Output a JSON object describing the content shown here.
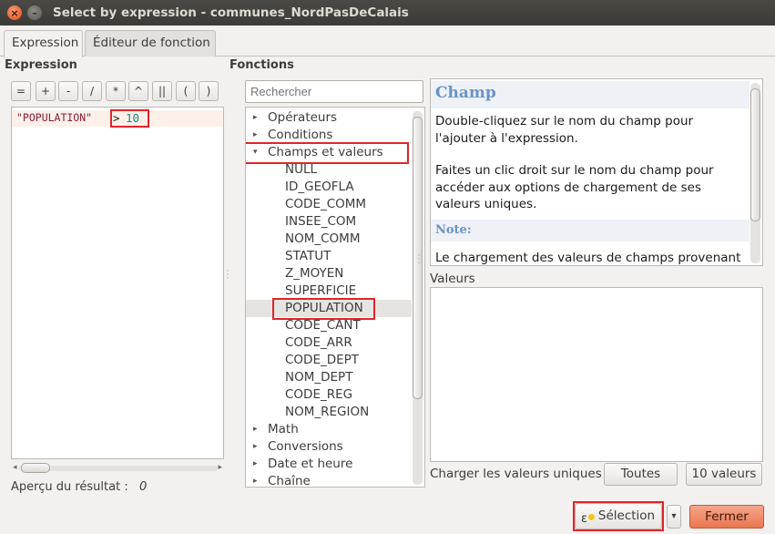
{
  "window": {
    "title": "Select by expression - communes_NordPasDeCalais",
    "close_glyph": "×",
    "minimize_glyph": "–"
  },
  "tabs": [
    {
      "label": "Expression"
    },
    {
      "label": "Éditeur de fonction"
    }
  ],
  "expression": {
    "section_label": "Expression",
    "operators": [
      "=",
      "+",
      "-",
      "/",
      "*",
      "^",
      "||",
      "(",
      ")"
    ],
    "field": "\"POPULATION\"",
    "operator": ">",
    "value": "10",
    "preview_label": "Aperçu du résultat :",
    "preview_value": "0"
  },
  "functions": {
    "section_label": "Fonctions",
    "search_placeholder": "Rechercher",
    "tree": {
      "operators": "Opérateurs",
      "conditions": "Conditions",
      "fields_values": "Champs et valeurs",
      "fields": [
        "NULL",
        "ID_GEOFLA",
        "CODE_COMM",
        "INSEE_COM",
        "NOM_COMM",
        "STATUT",
        "Z_MOYEN",
        "SUPERFICIE",
        "POPULATION",
        "CODE_CANT",
        "CODE_ARR",
        "CODE_DEPT",
        "NOM_DEPT",
        "CODE_REG",
        "NOM_REGION"
      ],
      "math": "Math",
      "conversions": "Conversions",
      "date_time": "Date et heure",
      "string": "Chaîne"
    },
    "selected_field": "POPULATION"
  },
  "help": {
    "title": "Champ",
    "p1": "Double-cliquez sur le nom du champ pour l'ajouter à l'expression.",
    "p2": "Faites un clic droit sur le nom du champ pour accéder aux options de chargement de ses valeurs uniques.",
    "note_title": "Note:",
    "p3": "Le chargement des valeurs de champs provenant"
  },
  "values": {
    "label": "Valeurs",
    "load_label": "Charger les valeurs uniques",
    "all_button": "Toutes",
    "ten_button": "10 valeurs"
  },
  "footer": {
    "select_button": "Sélection",
    "close_button": "Fermer",
    "dropdown_glyph": "▾"
  },
  "colors": {
    "highlight": "#e0252b",
    "accent_orange": "#e9764f",
    "help_title": "#6a93c4"
  }
}
